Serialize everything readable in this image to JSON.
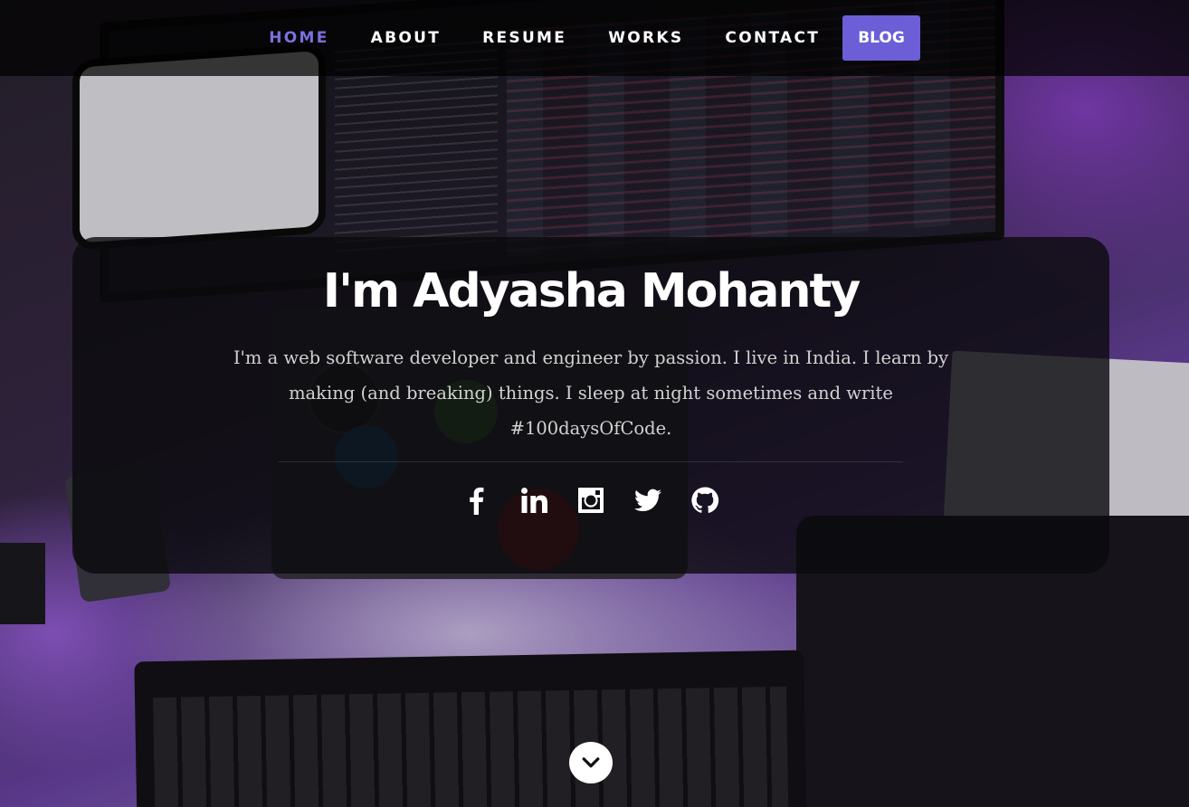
{
  "nav": {
    "items": [
      {
        "label": "HOME",
        "active": true
      },
      {
        "label": "ABOUT",
        "active": false
      },
      {
        "label": "RESUME",
        "active": false
      },
      {
        "label": "WORKS",
        "active": false
      },
      {
        "label": "CONTACT",
        "active": false
      }
    ],
    "blog_label": "BLOG"
  },
  "intro": {
    "heading": "I'm Adyasha Mohanty",
    "bio": "I'm a web software developer and engineer by passion. I live in India. I learn by making (and breaking) things. I sleep at night sometimes and write #100daysOfCode."
  },
  "social": [
    {
      "name": "facebook-icon"
    },
    {
      "name": "linkedin-icon"
    },
    {
      "name": "instagram-icon"
    },
    {
      "name": "twitter-icon"
    },
    {
      "name": "github-icon"
    }
  ],
  "scroll_icon": "chevron-down-icon",
  "colors": {
    "accent": "#6b5ed6",
    "active_nav": "#7b6fe0",
    "nav_bg": "rgba(0,0,0,0.72)",
    "card_bg": "rgba(10,10,12,0.80)"
  }
}
